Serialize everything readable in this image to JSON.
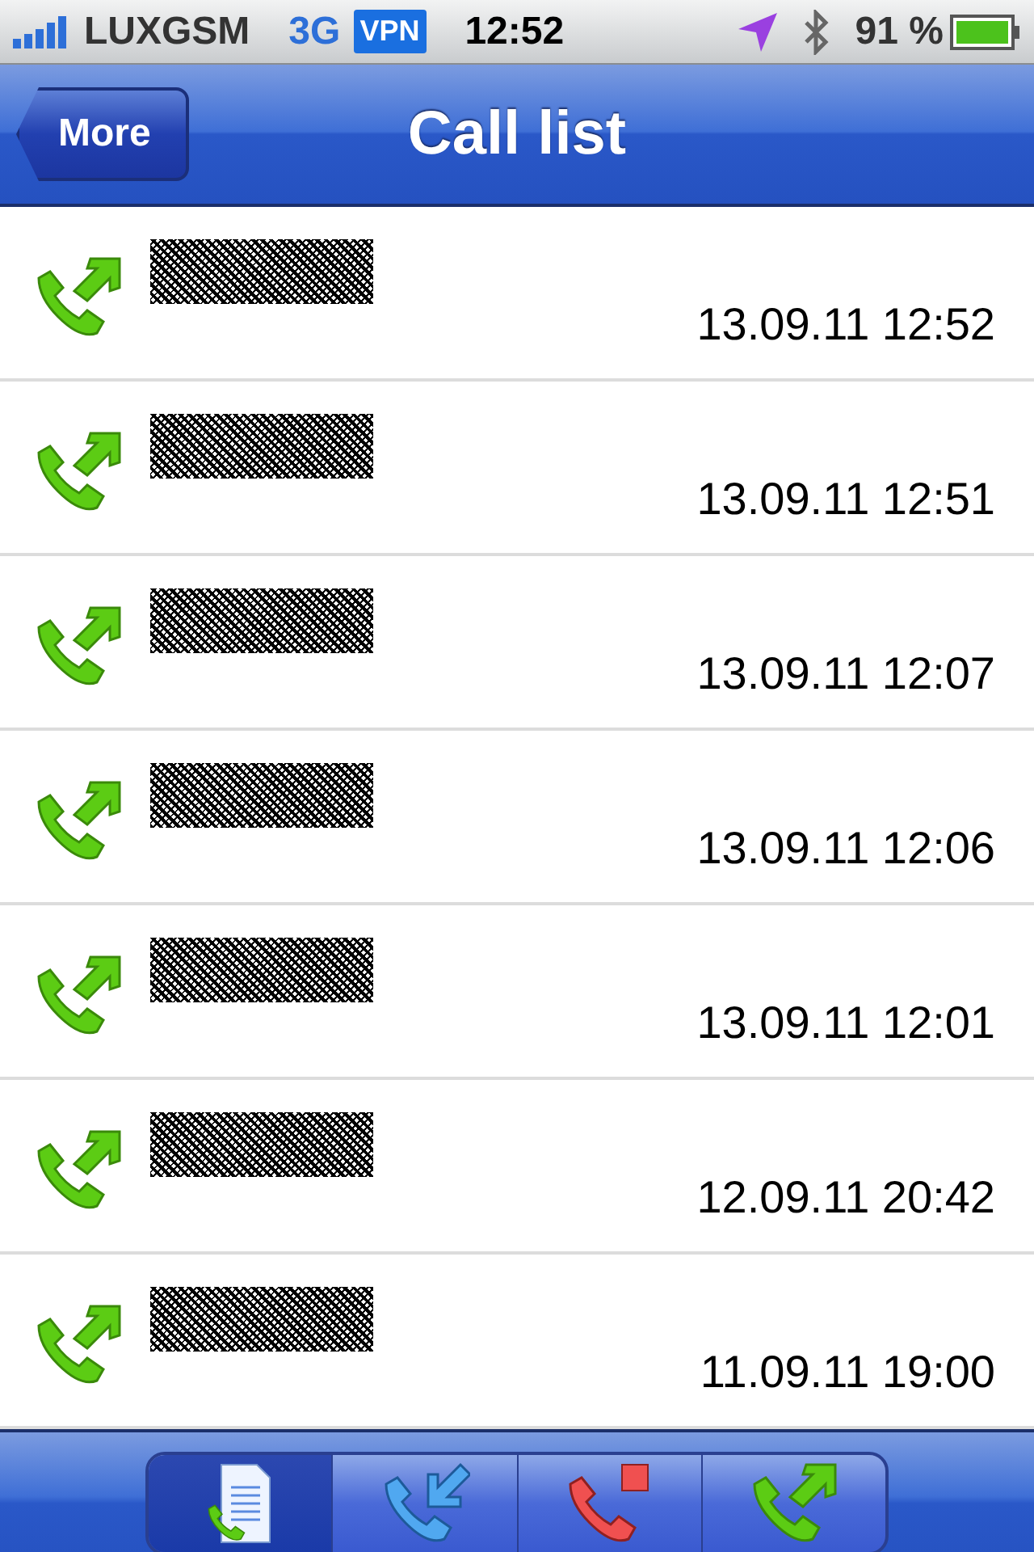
{
  "status_bar": {
    "carrier": "LUXGSM",
    "network": "3G",
    "vpn": "VPN",
    "time": "12:52",
    "battery": "91 %"
  },
  "nav_bar": {
    "back": "More",
    "title": "Call list"
  },
  "calls": [
    {
      "kind": "outgoing",
      "name_redacted": true,
      "time": "13.09.11 12:52"
    },
    {
      "kind": "outgoing",
      "name_redacted": true,
      "time": "13.09.11 12:51"
    },
    {
      "kind": "outgoing",
      "name_redacted": true,
      "time": "13.09.11 12:07"
    },
    {
      "kind": "outgoing",
      "name_redacted": true,
      "time": "13.09.11 12:06"
    },
    {
      "kind": "outgoing",
      "name_redacted": true,
      "time": "13.09.11 12:01"
    },
    {
      "kind": "outgoing",
      "name_redacted": true,
      "time": "12.09.11 20:42"
    },
    {
      "kind": "outgoing",
      "name_redacted": true,
      "time": "11.09.11 19:00"
    }
  ],
  "filter_tabs": [
    {
      "kind": "all",
      "selected": true
    },
    {
      "kind": "incoming",
      "selected": false
    },
    {
      "kind": "missed",
      "selected": false
    },
    {
      "kind": "outgoing",
      "selected": false
    }
  ]
}
